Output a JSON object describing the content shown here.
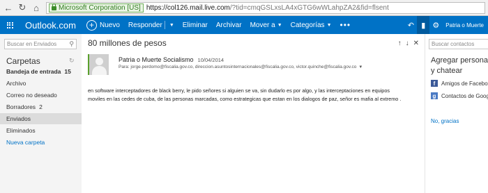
{
  "browser": {
    "cert_label": "Microsoft Corporation [US]",
    "url_host": "https://col126.mail.live.com",
    "url_rest": "/?tid=cmqGSLxsLA4xGTG6wWLahpZA2&fid=flsent"
  },
  "topbar": {
    "brand": "Outlook.com",
    "new_label": "Nuevo",
    "reply_label": "Responder",
    "delete_label": "Eliminar",
    "archive_label": "Archivar",
    "move_label": "Mover a",
    "categories_label": "Categorías",
    "user_name": "Patria o Muerte"
  },
  "sidebar": {
    "search_placeholder": "Buscar en Enviados",
    "folders_title": "Carpetas",
    "items": [
      {
        "label": "Bandeja de entrada",
        "count": "15"
      },
      {
        "label": "Archivo",
        "count": ""
      },
      {
        "label": "Correo no deseado",
        "count": ""
      },
      {
        "label": "Borradores",
        "count": "2"
      },
      {
        "label": "Enviados",
        "count": ""
      },
      {
        "label": "Eliminados",
        "count": ""
      }
    ],
    "new_folder": "Nueva carpeta"
  },
  "message": {
    "subject": "80 millones de pesos",
    "sender": "Patria o Muerte Socialismo",
    "date": "10/04/2014",
    "to_line": "Para: jorge.perdomo@fiscalia.gov.co, direccion.asuntosinternacionales@fiscalia.gov.co, victor.quinche@fiscalia.gov.co",
    "body": "en software interceptadores de black berry, le pido señores si alguien se va, sin dudarlo es por algo, y las interceptaciones en equipos moviles en las cedes de cuba,  de las personas marcadas, como estrategicas que estan en los dialogos de paz,  señor es mafia al extremo ."
  },
  "rightpane": {
    "search_placeholder": "Buscar contactos",
    "title": "Agregar personas y chatear",
    "facebook_label": "Amigos de Facebook",
    "google_label": "Contactos de Google",
    "no_thanks": "No, gracias"
  },
  "colors": {
    "brand_blue": "#0072c6",
    "nav_bg": "#f4f4f4",
    "selected_folder": "#dcdcdc"
  },
  "icons": [
    "back-icon",
    "refresh-icon",
    "home-icon",
    "lock-icon",
    "waffle-icon",
    "new-plus-icon",
    "undo-icon",
    "chat-icon",
    "gear-icon",
    "up-arrow-icon",
    "down-arrow-icon",
    "close-icon",
    "facebook-icon",
    "google-icon"
  ]
}
